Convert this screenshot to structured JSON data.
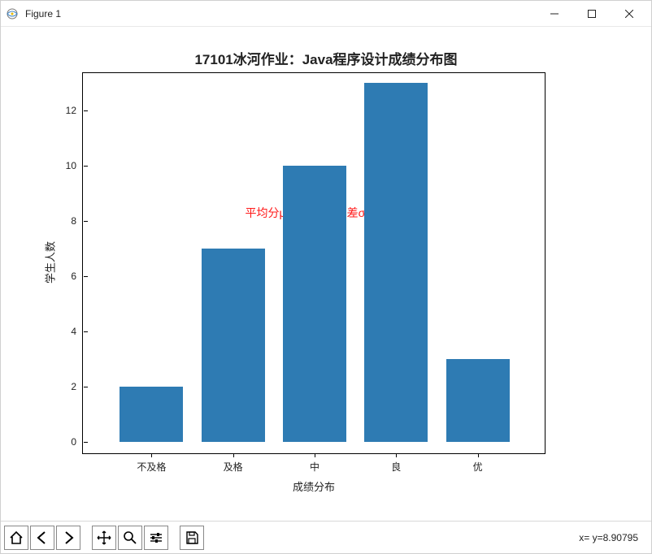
{
  "window": {
    "title": "Figure 1"
  },
  "chart_data": {
    "type": "bar",
    "title": "17101冰河作业：Java程序设计成绩分布图",
    "xlabel": "成绩分布",
    "ylabel": "学生人数",
    "categories": [
      "不及格",
      "及格",
      "中",
      "良",
      "优"
    ],
    "values": [
      2,
      7,
      10,
      13,
      3
    ],
    "ylim": [
      0,
      13
    ],
    "yticks": [
      0,
      2,
      4,
      6,
      8,
      10,
      12
    ],
    "annotation": "平均分μ=77.46,标准差σ=9.635",
    "bar_color": "#2e7bb3"
  },
  "toolbar": {
    "home": "home-icon",
    "back": "back-icon",
    "forward": "forward-icon",
    "pan": "pan-icon",
    "zoom": "zoom-icon",
    "config": "config-icon",
    "save": "save-icon",
    "coords": "x= y=8.90795"
  }
}
